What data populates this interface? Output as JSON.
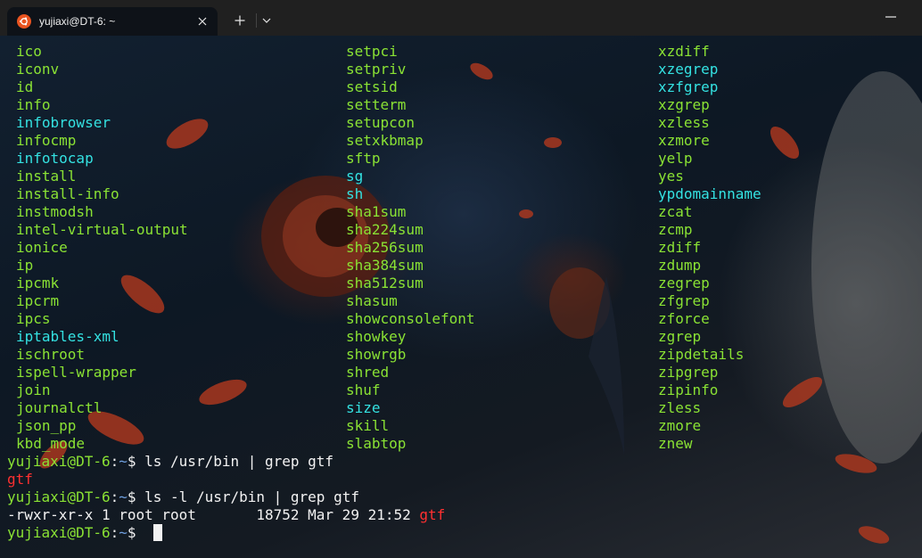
{
  "window": {
    "tab_title": "yujiaxi@DT-6: ~",
    "tab_icon": "ubuntu-icon",
    "buttons": [
      "close-icon",
      "plus-icon",
      "chevron-down-icon",
      "minimize-icon"
    ]
  },
  "colors": {
    "executable": "#8ae234",
    "symlink": "#34e2e2",
    "match": "#ff3030",
    "prompt_user": "#8ae234",
    "prompt_path": "#6fa0e0",
    "accent": "#e95420"
  },
  "listing": {
    "col1": [
      "ico",
      "iconv",
      "id",
      "info",
      "infobrowser",
      "infocmp",
      "infotocap",
      "install",
      "install-info",
      "instmodsh",
      "intel-virtual-output",
      "ionice",
      "ip",
      "ipcmk",
      "ipcrm",
      "ipcs",
      "iptables-xml",
      "ischroot",
      "ispell-wrapper",
      "join",
      "journalctl",
      "json_pp",
      "kbd_mode"
    ],
    "col1_type": [
      "e",
      "e",
      "e",
      "e",
      "l",
      "e",
      "l",
      "e",
      "e",
      "e",
      "e",
      "e",
      "e",
      "e",
      "e",
      "e",
      "l",
      "e",
      "e",
      "e",
      "e",
      "e",
      "e"
    ],
    "col2": [
      "setpci",
      "setpriv",
      "setsid",
      "setterm",
      "setupcon",
      "setxkbmap",
      "sftp",
      "sg",
      "sh",
      "sha1sum",
      "sha224sum",
      "sha256sum",
      "sha384sum",
      "sha512sum",
      "shasum",
      "showconsolefont",
      "showkey",
      "showrgb",
      "shred",
      "shuf",
      "size",
      "skill",
      "slabtop"
    ],
    "col2_type": [
      "e",
      "e",
      "e",
      "e",
      "e",
      "e",
      "e",
      "l",
      "l",
      "e",
      "e",
      "e",
      "e",
      "e",
      "e",
      "e",
      "e",
      "e",
      "e",
      "e",
      "l",
      "e",
      "e"
    ],
    "col3": [
      "xzdiff",
      "xzegrep",
      "xzfgrep",
      "xzgrep",
      "xzless",
      "xzmore",
      "yelp",
      "yes",
      "ypdomainname",
      "zcat",
      "zcmp",
      "zdiff",
      "zdump",
      "zegrep",
      "zfgrep",
      "zforce",
      "zgrep",
      "zipdetails",
      "zipgrep",
      "zipinfo",
      "zless",
      "zmore",
      "znew"
    ],
    "col3_type": [
      "e",
      "l",
      "l",
      "e",
      "e",
      "e",
      "e",
      "e",
      "l",
      "e",
      "e",
      "e",
      "e",
      "e",
      "e",
      "e",
      "e",
      "e",
      "e",
      "e",
      "e",
      "e",
      "e"
    ]
  },
  "session": {
    "prompt_user": "yujiaxi@DT-6",
    "prompt_sep": ":",
    "prompt_path": "~",
    "prompt_end": "$ ",
    "cmd1": "ls /usr/bin | grep gtf",
    "out1": "gtf",
    "cmd2": "ls -l /usr/bin | grep gtf",
    "out2_prefix": "-rwxr-xr-x 1 root root       18752 Mar 29 21:52 ",
    "out2_match": "gtf"
  }
}
